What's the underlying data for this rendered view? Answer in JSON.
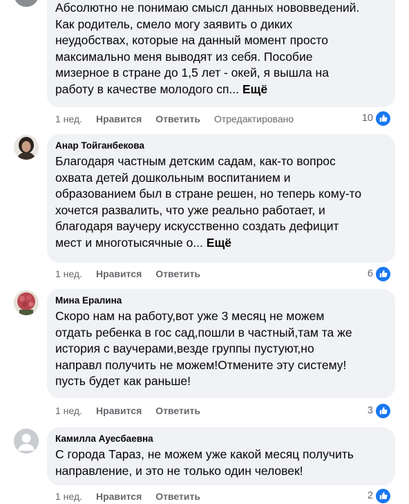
{
  "colors": {
    "bubble": "#f0f2f5",
    "meta": "#65676b",
    "like_blue": "#1877f2"
  },
  "comments": [
    {
      "text": "Абсолютно не понимаю смысл данных нововведений.\nКак родитель, смело могу заявить о диких\nнеудобствах, которые на данный момент просто\nмаксимально меня выводят из себя. Пособие\nмизерное в стране до 1,5 лет - окей, я вышла на\nработу в качестве молодого сп... ",
      "more": "Ещё",
      "time": "1 нед.",
      "like": "Нравится",
      "reply": "Ответить",
      "edited": "Отредактировано",
      "reactions": "10",
      "reaction_icon": "thumbs-up-icon"
    },
    {
      "author": "Анар Тойганбекова",
      "text": "Благодаря частным детским садам, как-то вопрос\nохвата детей дошкольным воспитанием и\nобразованием был в стране решен, но теперь кому-то\nхочется развалить, что уже реально работает, и\nблагодаря ваучеру искусственно создать дефицит\nмест и многотысячные о... ",
      "more": "Ещё",
      "time": "1 нед.",
      "like": "Нравится",
      "reply": "Ответить",
      "reactions": "6",
      "reaction_icon": "thumbs-up-icon"
    },
    {
      "author": "Мина Ералина",
      "text": "Скоро нам на работу,вот уже 3 месяц не можем\nотдать ребенка в гос сад,пошли в частный,там та же\nистория с ваучерами,везде группы пустуют,но\nнаправл получить не можем!Отмените эту систему!\nпусть будет как раньше!",
      "time": "1 нед.",
      "like": "Нравится",
      "reply": "Ответить",
      "reactions": "3",
      "reaction_icon": "thumbs-up-icon"
    },
    {
      "author": "Камилла Ауесбаевна",
      "text": "С города Тараз, не можем уже какой месяц получить\nнаправление, и это не только один человек!",
      "time": "1 нед.",
      "like": "Нравится",
      "reply": "Ответить",
      "reactions": "2",
      "reaction_icon": "thumbs-up-icon"
    }
  ]
}
